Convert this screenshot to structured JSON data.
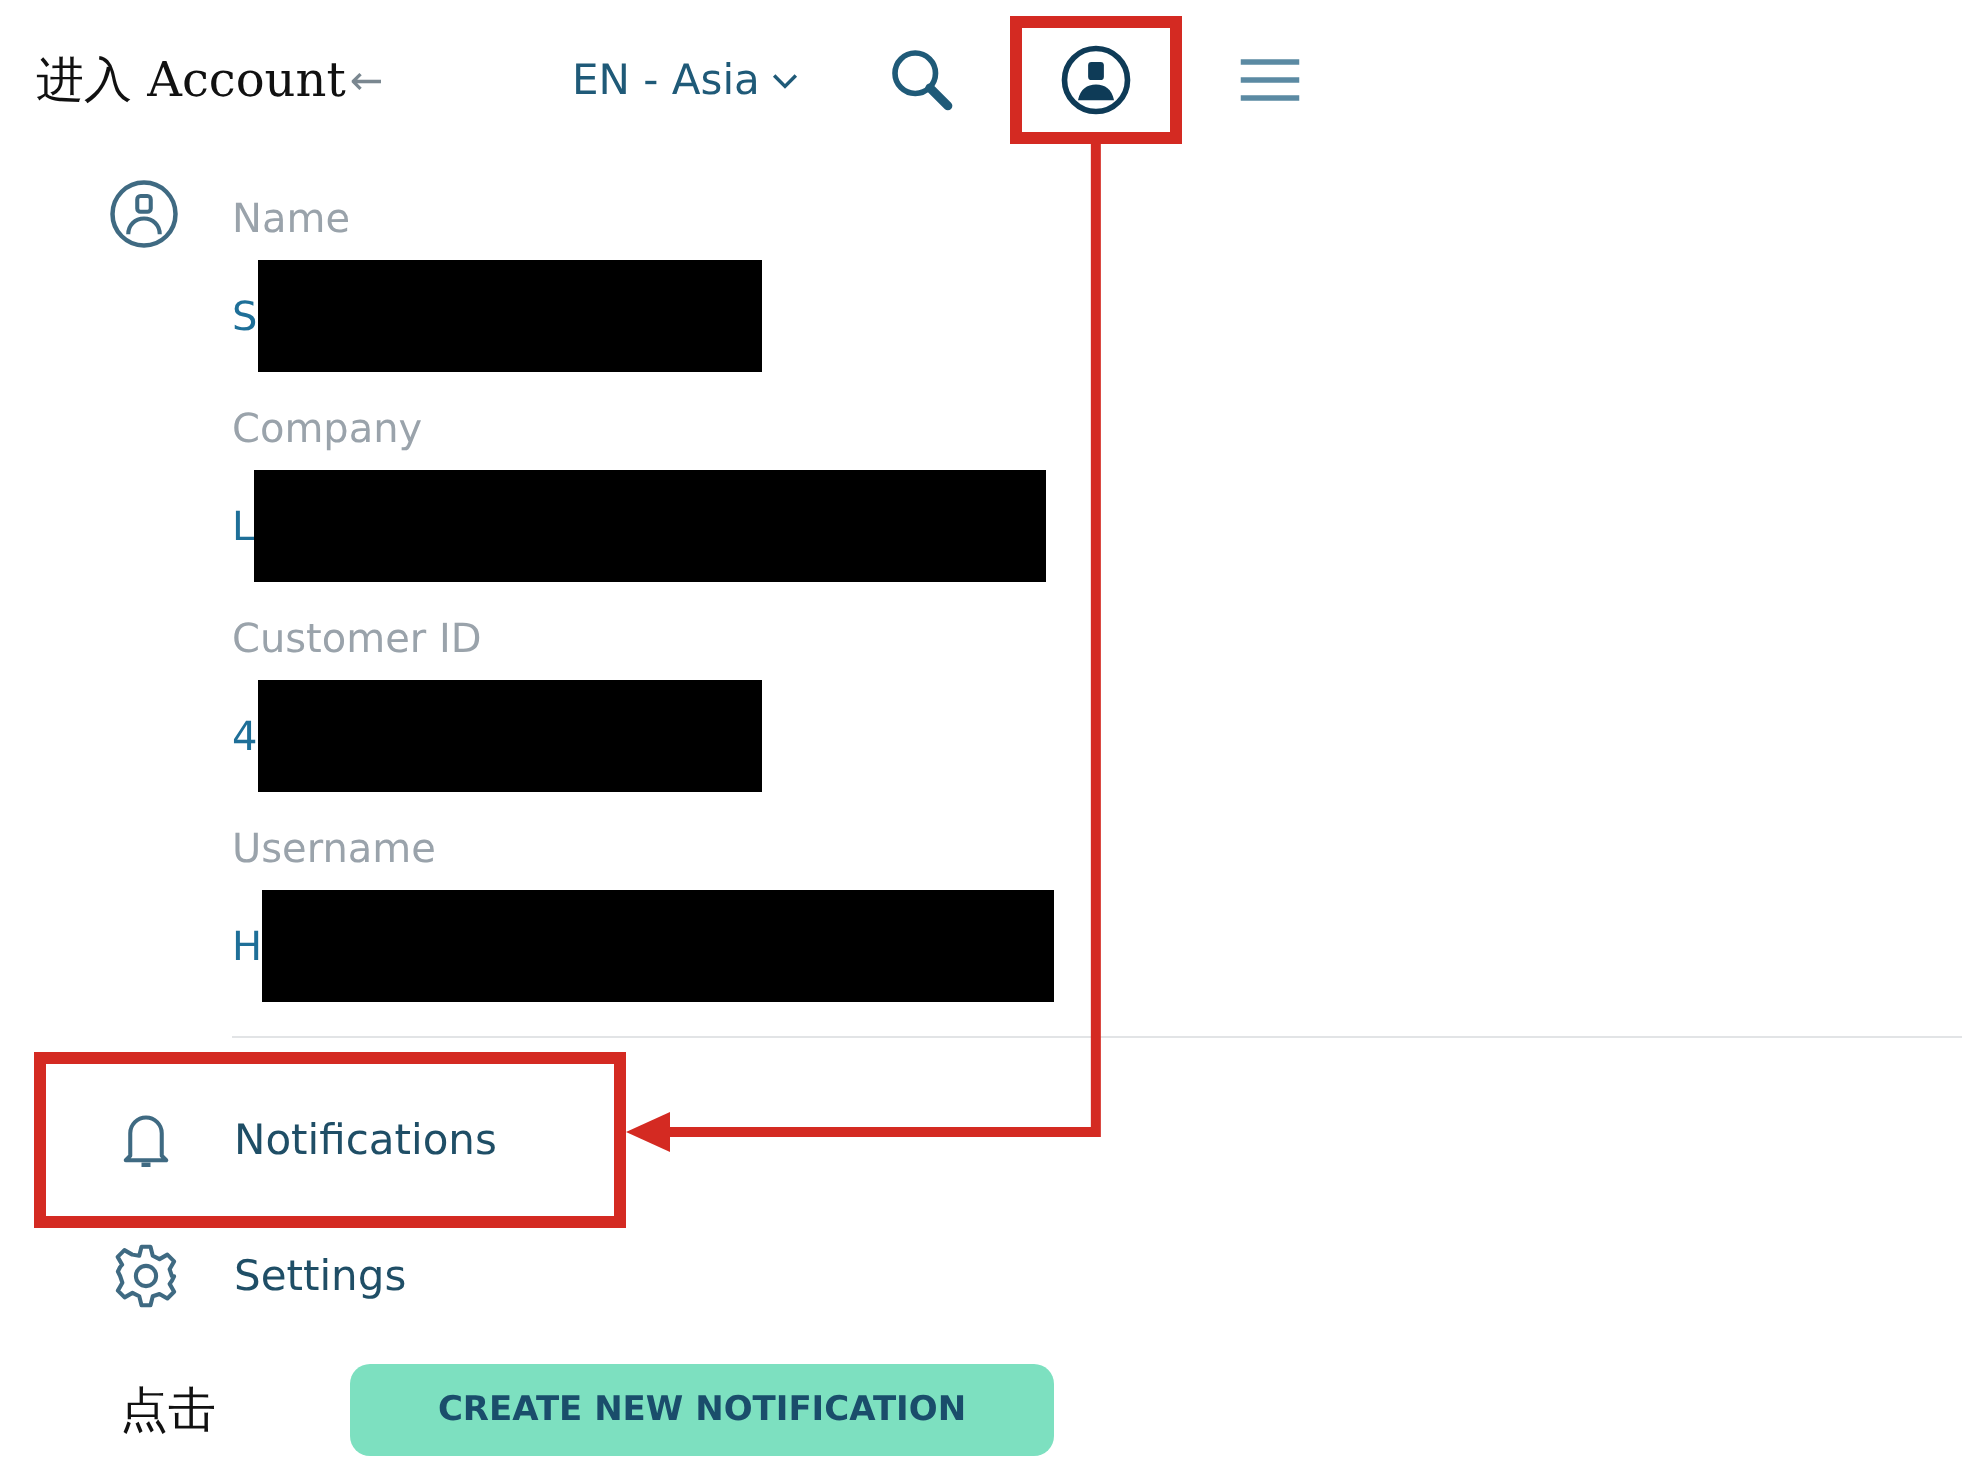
{
  "header": {
    "caption": "进入 Account",
    "back_glyph": "←",
    "region": "EN - Asia",
    "icons": [
      {
        "kind": "search",
        "highlighted": false
      },
      {
        "kind": "account",
        "highlighted": true
      },
      {
        "kind": "menu",
        "highlighted": false
      }
    ]
  },
  "profile": {
    "fields": [
      {
        "label": "Name",
        "value": "S",
        "kind": "short"
      },
      {
        "label": "Company",
        "value": "L",
        "kind": "long"
      },
      {
        "label": "Customer ID",
        "value": "4",
        "kind": "short"
      },
      {
        "label": "Username",
        "value": "H",
        "kind": "long"
      }
    ]
  },
  "menu": [
    {
      "kind": "notifications",
      "label": "Notifications",
      "highlighted": true
    },
    {
      "kind": "settings",
      "label": "Settings",
      "highlighted": false
    }
  ],
  "footer": {
    "caption": "点击",
    "button": "CREATE NEW NOTIFICATION"
  }
}
